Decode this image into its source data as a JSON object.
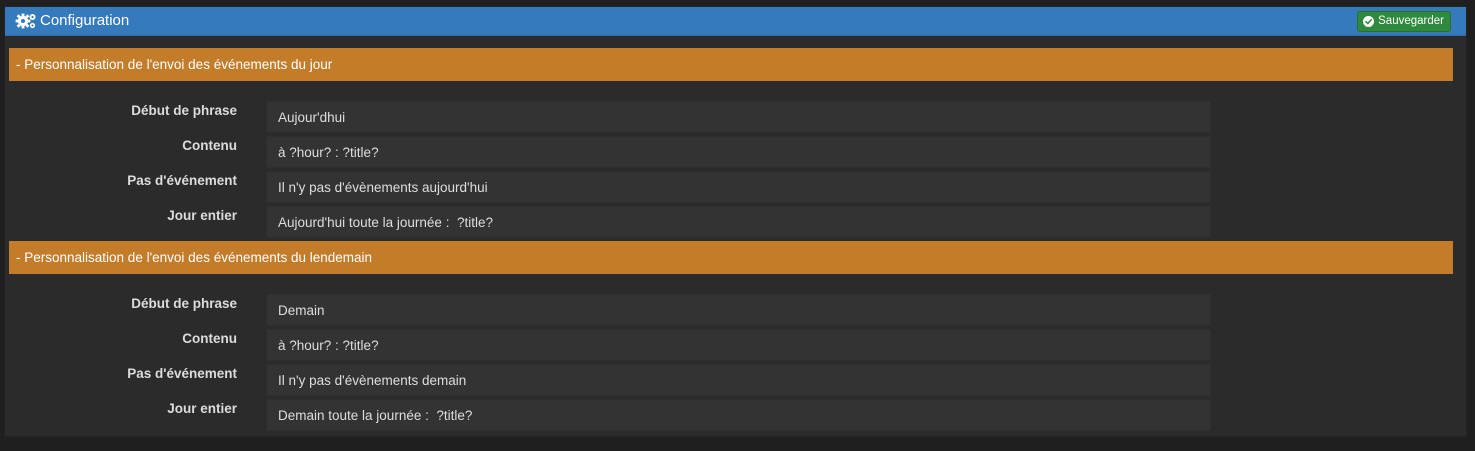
{
  "panel": {
    "title": "Configuration",
    "icon": "gears-icon",
    "save_label": "Sauvegarder",
    "save_icon": "check-circle-icon"
  },
  "colors": {
    "heading_bg": "#357abd",
    "section_bg": "#c37c2a",
    "save_bg": "#2e8b3e",
    "panel_bg": "#2b2b2b",
    "input_bg": "#333333"
  },
  "sections": [
    {
      "title": "- Personnalisation de l'envoi des événements du jour",
      "fields": [
        {
          "label": "Début de phrase",
          "value": "Aujour'dhui"
        },
        {
          "label": "Contenu",
          "value": "à ?hour? : ?title?"
        },
        {
          "label": "Pas d'événement",
          "value": "Il n'y pas d'évènements aujourd'hui"
        },
        {
          "label": "Jour entier",
          "value": "Aujourd'hui toute la journée :  ?title?"
        }
      ]
    },
    {
      "title": "- Personnalisation de l'envoi des événements du lendemain",
      "fields": [
        {
          "label": "Début de phrase",
          "value": "Demain"
        },
        {
          "label": "Contenu",
          "value": "à ?hour? : ?title?"
        },
        {
          "label": "Pas d'événement",
          "value": "Il n'y pas d'évènements demain"
        },
        {
          "label": "Jour entier",
          "value": "Demain toute la journée :  ?title?"
        }
      ]
    }
  ]
}
